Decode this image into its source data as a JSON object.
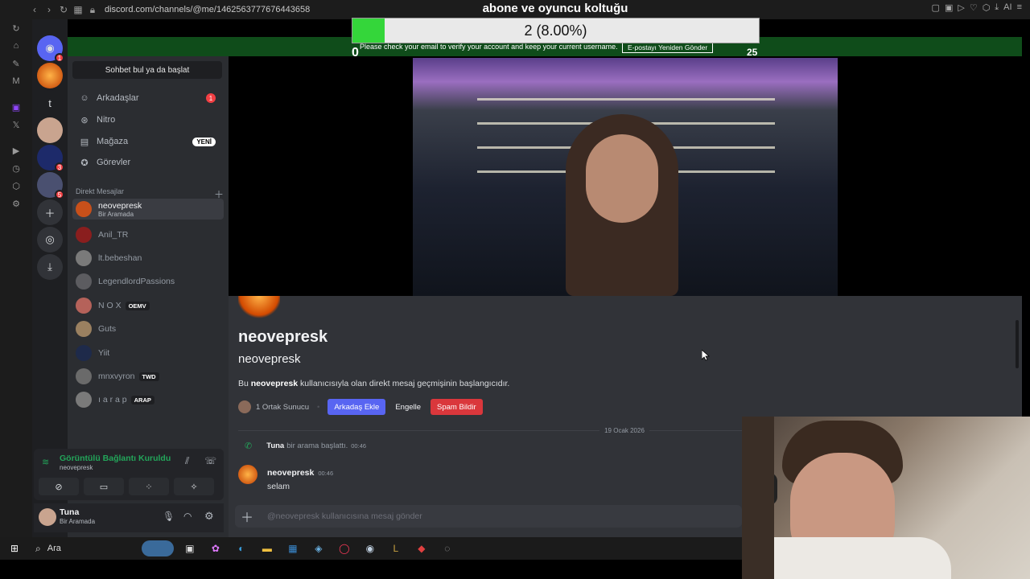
{
  "browser": {
    "url": "discord.com/channels/@me/1462563777676443658",
    "stream_title": "abone ve oyuncu koltuğu",
    "ai_label": "AI"
  },
  "overlay": {
    "progress_text": "2 (8.00%)",
    "progress_value": 0.08,
    "min_label": "0",
    "max_label": "25",
    "verify_message": "Please check your email to verify your account and keep your current username.",
    "verify_button": "E-postayı Yeniden Gönder"
  },
  "server_rail": {
    "dm_badge": "1",
    "badge_3": "3",
    "badge_5": "5",
    "t_label": "t"
  },
  "sidebar": {
    "find_button": "Sohbet bul ya da başlat",
    "nav": [
      {
        "label": "Arkadaşlar",
        "badge": "1"
      },
      {
        "label": "Nitro"
      },
      {
        "label": "Mağaza",
        "badge": "YENİ"
      },
      {
        "label": "Görevler"
      }
    ],
    "dm_header": "Direkt Mesajlar",
    "dms": [
      {
        "name": "neovepresk",
        "sub": "Bir Aramada",
        "color": "#c8501a"
      },
      {
        "name": "Anil_TR",
        "color": "#8a1e1e"
      },
      {
        "name": "lt.bebeshan",
        "color": "#7a7a7a"
      },
      {
        "name": "LegendlordPassions",
        "color": "#5c5c60"
      },
      {
        "name": "N O X",
        "tag": "OEMV",
        "color": "#b5625a"
      },
      {
        "name": "Guts",
        "color": "#9a8060"
      },
      {
        "name": "Yiit",
        "color": "#1e2a4a"
      },
      {
        "name": "mnxvyron",
        "tag": "TWD",
        "color": "#6a6a6a"
      },
      {
        "name": "ı a r a p",
        "tag": "ARAP",
        "color": "#7a7a7a"
      }
    ]
  },
  "voice": {
    "title": "Görüntülü Bağlantı Kuruldu",
    "sub": "neovepresk"
  },
  "user": {
    "name": "Tuna",
    "status": "Bir Aramada"
  },
  "profile": {
    "display_name": "neovepresk",
    "username": "neovepresk",
    "desc_prefix": "Bu ",
    "desc_bold": "neovepresk",
    "desc_suffix": " kullanıcısıyla olan direkt mesaj geçmişinin başlangıcıdır.",
    "mutual": "1 Ortak Sunucu",
    "add_friend": "Arkadaş Ekle",
    "block": "Engelle",
    "report_spam": "Spam Bildir"
  },
  "chat": {
    "date": "19 Ocak 2026",
    "call_user": "Tuna",
    "call_text": "bir arama başlattı.",
    "call_time": "00:46",
    "msg_author": "neovepresk",
    "msg_time": "00:46",
    "msg_text": "selam",
    "composer_placeholder": "@neovepresk kullanıcısına mesaj gönder"
  },
  "taskbar": {
    "search": "Ara"
  }
}
